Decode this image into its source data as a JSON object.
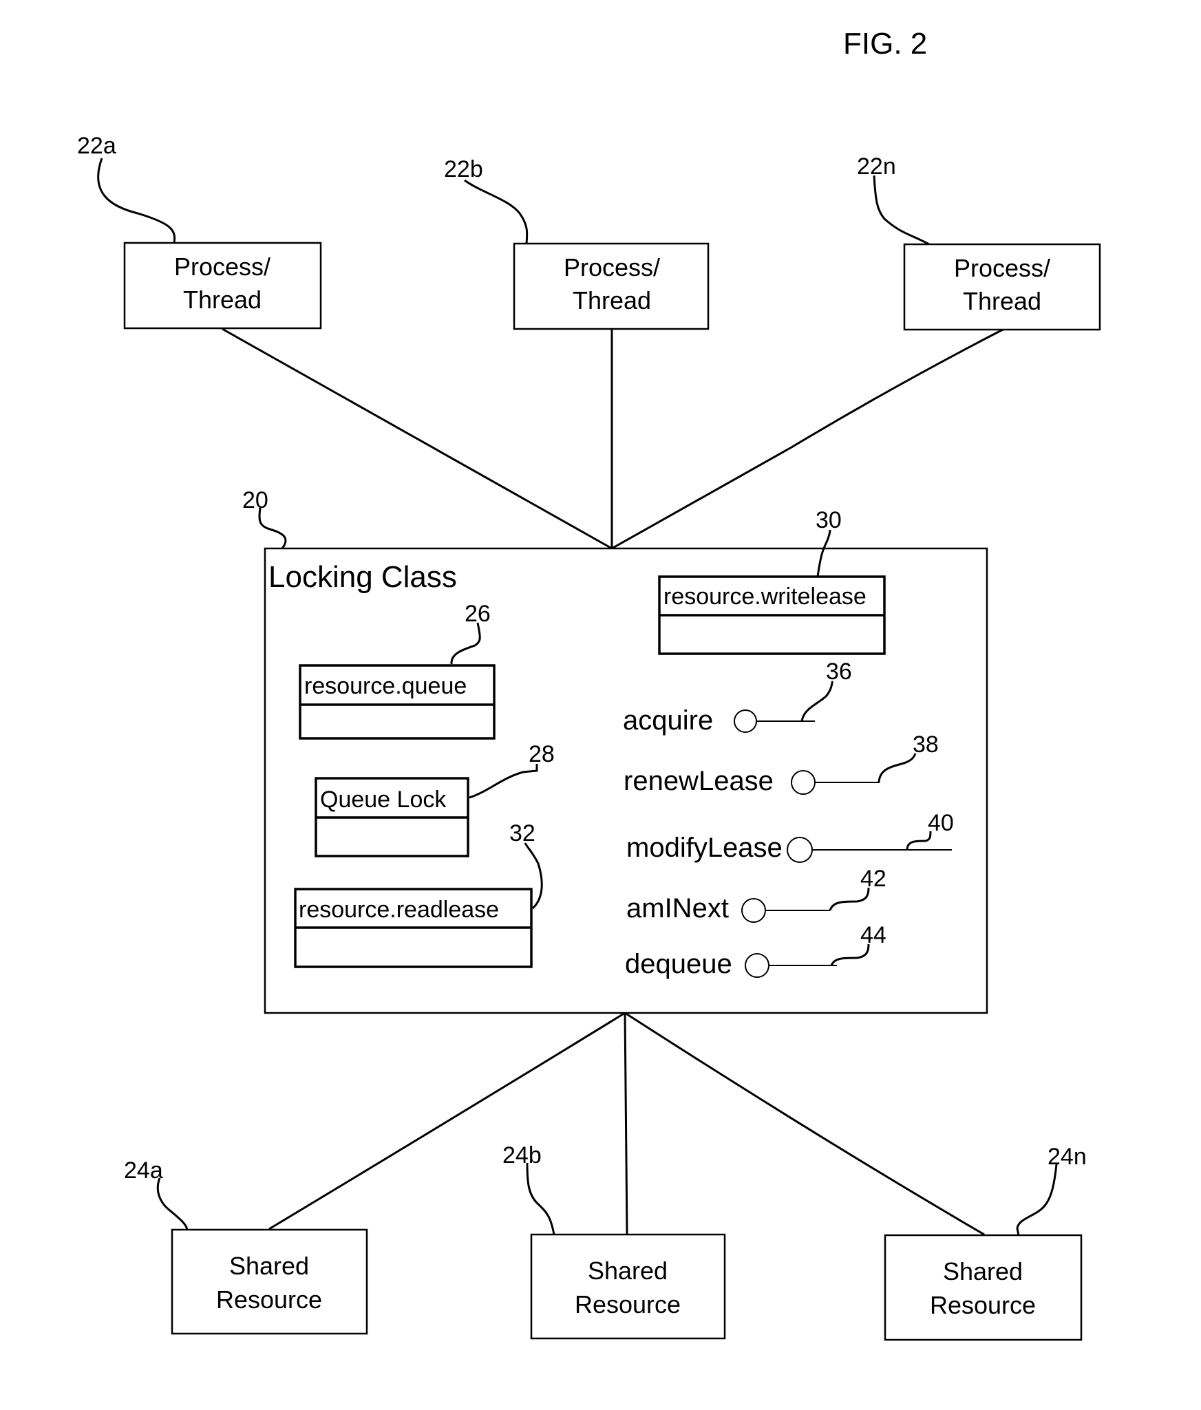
{
  "figure": {
    "title": "FIG. 2"
  },
  "processes": [
    {
      "ref": "22a",
      "line1": "Process/",
      "line2": "Thread"
    },
    {
      "ref": "22b",
      "line1": "Process/",
      "line2": "Thread"
    },
    {
      "ref": "22n",
      "line1": "Process/",
      "line2": "Thread"
    }
  ],
  "locking_class": {
    "ref": "20",
    "title": "Locking Class",
    "members": [
      {
        "ref": "26",
        "name": "resource.queue"
      },
      {
        "ref": "28",
        "name": "Queue Lock"
      },
      {
        "ref": "32",
        "name": "resource.readlease"
      },
      {
        "ref": "30",
        "name": "resource.writelease"
      }
    ],
    "methods": [
      {
        "ref": "36",
        "name": "acquire"
      },
      {
        "ref": "38",
        "name": "renewLease"
      },
      {
        "ref": "40",
        "name": "modifyLease"
      },
      {
        "ref": "42",
        "name": "amINext"
      },
      {
        "ref": "44",
        "name": "dequeue"
      }
    ]
  },
  "resources": [
    {
      "ref": "24a",
      "line1": "Shared",
      "line2": "Resource"
    },
    {
      "ref": "24b",
      "line1": "Shared",
      "line2": "Resource"
    },
    {
      "ref": "24n",
      "line1": "Shared",
      "line2": "Resource"
    }
  ]
}
